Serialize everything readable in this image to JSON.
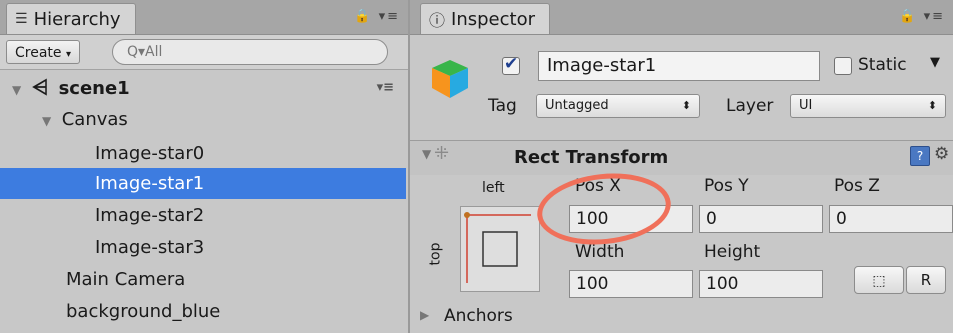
{
  "hierarchy": {
    "tab_title": "Hierarchy",
    "create_label": "Create",
    "search_placeholder": "Q▾All",
    "scene_name": "scene1",
    "items": [
      {
        "label": "Canvas"
      },
      {
        "label": "Image-star0"
      },
      {
        "label": "Image-star1"
      },
      {
        "label": "Image-star2"
      },
      {
        "label": "Image-star3"
      },
      {
        "label": "Main Camera"
      },
      {
        "label": "background_blue"
      }
    ]
  },
  "inspector": {
    "tab_title": "Inspector",
    "object_name": "Image-star1",
    "static_label": "Static",
    "tag_label": "Tag",
    "tag_value": "Untagged",
    "layer_label": "Layer",
    "layer_value": "UI",
    "component_title": "Rect Transform",
    "anchor_h_label": "left",
    "anchor_v_label": "top",
    "pos_x_label": "Pos X",
    "pos_y_label": "Pos Y",
    "pos_z_label": "Pos Z",
    "pos_x_value": "100",
    "pos_y_value": "0",
    "pos_z_value": "0",
    "width_label": "Width",
    "height_label": "Height",
    "width_value": "100",
    "height_value": "100",
    "r_button_label": "R",
    "anchors_label": "Anchors"
  },
  "colors": {
    "selection": "#3d7ce0",
    "highlight_circle": "#f0705a"
  }
}
